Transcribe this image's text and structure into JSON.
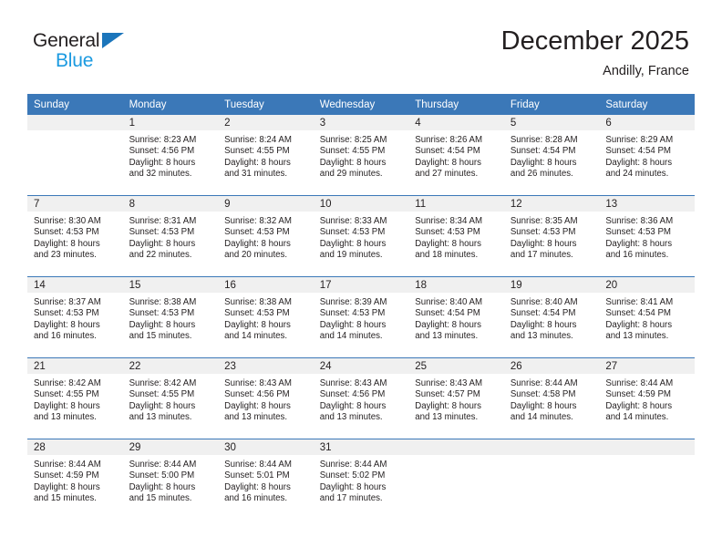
{
  "brand": {
    "name_top": "General",
    "name_bottom": "Blue",
    "triangle_color": "#1b75bb",
    "blue_color": "#1b9ae0"
  },
  "header": {
    "title": "December 2025",
    "subtitle": "Andilly, France"
  },
  "theme": {
    "header_blue": "#3b78b8",
    "daynum_band": "#f0f0f0",
    "text": "#231f20"
  },
  "weekday_headers": [
    "Sunday",
    "Monday",
    "Tuesday",
    "Wednesday",
    "Thursday",
    "Friday",
    "Saturday"
  ],
  "labels": {
    "sunrise_prefix": "Sunrise:",
    "sunset_prefix": "Sunset:",
    "daylight_prefix": "Daylight:"
  },
  "weeks": [
    [
      {
        "day": "",
        "empty": true
      },
      {
        "day": "1",
        "sunrise": "Sunrise: 8:23 AM",
        "sunset": "Sunset: 4:56 PM",
        "daylight1": "Daylight: 8 hours",
        "daylight2": "and 32 minutes."
      },
      {
        "day": "2",
        "sunrise": "Sunrise: 8:24 AM",
        "sunset": "Sunset: 4:55 PM",
        "daylight1": "Daylight: 8 hours",
        "daylight2": "and 31 minutes."
      },
      {
        "day": "3",
        "sunrise": "Sunrise: 8:25 AM",
        "sunset": "Sunset: 4:55 PM",
        "daylight1": "Daylight: 8 hours",
        "daylight2": "and 29 minutes."
      },
      {
        "day": "4",
        "sunrise": "Sunrise: 8:26 AM",
        "sunset": "Sunset: 4:54 PM",
        "daylight1": "Daylight: 8 hours",
        "daylight2": "and 27 minutes."
      },
      {
        "day": "5",
        "sunrise": "Sunrise: 8:28 AM",
        "sunset": "Sunset: 4:54 PM",
        "daylight1": "Daylight: 8 hours",
        "daylight2": "and 26 minutes."
      },
      {
        "day": "6",
        "sunrise": "Sunrise: 8:29 AM",
        "sunset": "Sunset: 4:54 PM",
        "daylight1": "Daylight: 8 hours",
        "daylight2": "and 24 minutes."
      }
    ],
    [
      {
        "day": "7",
        "sunrise": "Sunrise: 8:30 AM",
        "sunset": "Sunset: 4:53 PM",
        "daylight1": "Daylight: 8 hours",
        "daylight2": "and 23 minutes."
      },
      {
        "day": "8",
        "sunrise": "Sunrise: 8:31 AM",
        "sunset": "Sunset: 4:53 PM",
        "daylight1": "Daylight: 8 hours",
        "daylight2": "and 22 minutes."
      },
      {
        "day": "9",
        "sunrise": "Sunrise: 8:32 AM",
        "sunset": "Sunset: 4:53 PM",
        "daylight1": "Daylight: 8 hours",
        "daylight2": "and 20 minutes."
      },
      {
        "day": "10",
        "sunrise": "Sunrise: 8:33 AM",
        "sunset": "Sunset: 4:53 PM",
        "daylight1": "Daylight: 8 hours",
        "daylight2": "and 19 minutes."
      },
      {
        "day": "11",
        "sunrise": "Sunrise: 8:34 AM",
        "sunset": "Sunset: 4:53 PM",
        "daylight1": "Daylight: 8 hours",
        "daylight2": "and 18 minutes."
      },
      {
        "day": "12",
        "sunrise": "Sunrise: 8:35 AM",
        "sunset": "Sunset: 4:53 PM",
        "daylight1": "Daylight: 8 hours",
        "daylight2": "and 17 minutes."
      },
      {
        "day": "13",
        "sunrise": "Sunrise: 8:36 AM",
        "sunset": "Sunset: 4:53 PM",
        "daylight1": "Daylight: 8 hours",
        "daylight2": "and 16 minutes."
      }
    ],
    [
      {
        "day": "14",
        "sunrise": "Sunrise: 8:37 AM",
        "sunset": "Sunset: 4:53 PM",
        "daylight1": "Daylight: 8 hours",
        "daylight2": "and 16 minutes."
      },
      {
        "day": "15",
        "sunrise": "Sunrise: 8:38 AM",
        "sunset": "Sunset: 4:53 PM",
        "daylight1": "Daylight: 8 hours",
        "daylight2": "and 15 minutes."
      },
      {
        "day": "16",
        "sunrise": "Sunrise: 8:38 AM",
        "sunset": "Sunset: 4:53 PM",
        "daylight1": "Daylight: 8 hours",
        "daylight2": "and 14 minutes."
      },
      {
        "day": "17",
        "sunrise": "Sunrise: 8:39 AM",
        "sunset": "Sunset: 4:53 PM",
        "daylight1": "Daylight: 8 hours",
        "daylight2": "and 14 minutes."
      },
      {
        "day": "18",
        "sunrise": "Sunrise: 8:40 AM",
        "sunset": "Sunset: 4:54 PM",
        "daylight1": "Daylight: 8 hours",
        "daylight2": "and 13 minutes."
      },
      {
        "day": "19",
        "sunrise": "Sunrise: 8:40 AM",
        "sunset": "Sunset: 4:54 PM",
        "daylight1": "Daylight: 8 hours",
        "daylight2": "and 13 minutes."
      },
      {
        "day": "20",
        "sunrise": "Sunrise: 8:41 AM",
        "sunset": "Sunset: 4:54 PM",
        "daylight1": "Daylight: 8 hours",
        "daylight2": "and 13 minutes."
      }
    ],
    [
      {
        "day": "21",
        "sunrise": "Sunrise: 8:42 AM",
        "sunset": "Sunset: 4:55 PM",
        "daylight1": "Daylight: 8 hours",
        "daylight2": "and 13 minutes."
      },
      {
        "day": "22",
        "sunrise": "Sunrise: 8:42 AM",
        "sunset": "Sunset: 4:55 PM",
        "daylight1": "Daylight: 8 hours",
        "daylight2": "and 13 minutes."
      },
      {
        "day": "23",
        "sunrise": "Sunrise: 8:43 AM",
        "sunset": "Sunset: 4:56 PM",
        "daylight1": "Daylight: 8 hours",
        "daylight2": "and 13 minutes."
      },
      {
        "day": "24",
        "sunrise": "Sunrise: 8:43 AM",
        "sunset": "Sunset: 4:56 PM",
        "daylight1": "Daylight: 8 hours",
        "daylight2": "and 13 minutes."
      },
      {
        "day": "25",
        "sunrise": "Sunrise: 8:43 AM",
        "sunset": "Sunset: 4:57 PM",
        "daylight1": "Daylight: 8 hours",
        "daylight2": "and 13 minutes."
      },
      {
        "day": "26",
        "sunrise": "Sunrise: 8:44 AM",
        "sunset": "Sunset: 4:58 PM",
        "daylight1": "Daylight: 8 hours",
        "daylight2": "and 14 minutes."
      },
      {
        "day": "27",
        "sunrise": "Sunrise: 8:44 AM",
        "sunset": "Sunset: 4:59 PM",
        "daylight1": "Daylight: 8 hours",
        "daylight2": "and 14 minutes."
      }
    ],
    [
      {
        "day": "28",
        "sunrise": "Sunrise: 8:44 AM",
        "sunset": "Sunset: 4:59 PM",
        "daylight1": "Daylight: 8 hours",
        "daylight2": "and 15 minutes."
      },
      {
        "day": "29",
        "sunrise": "Sunrise: 8:44 AM",
        "sunset": "Sunset: 5:00 PM",
        "daylight1": "Daylight: 8 hours",
        "daylight2": "and 15 minutes."
      },
      {
        "day": "30",
        "sunrise": "Sunrise: 8:44 AM",
        "sunset": "Sunset: 5:01 PM",
        "daylight1": "Daylight: 8 hours",
        "daylight2": "and 16 minutes."
      },
      {
        "day": "31",
        "sunrise": "Sunrise: 8:44 AM",
        "sunset": "Sunset: 5:02 PM",
        "daylight1": "Daylight: 8 hours",
        "daylight2": "and 17 minutes."
      },
      {
        "day": "",
        "empty": true
      },
      {
        "day": "",
        "empty": true
      },
      {
        "day": "",
        "empty": true
      }
    ]
  ]
}
